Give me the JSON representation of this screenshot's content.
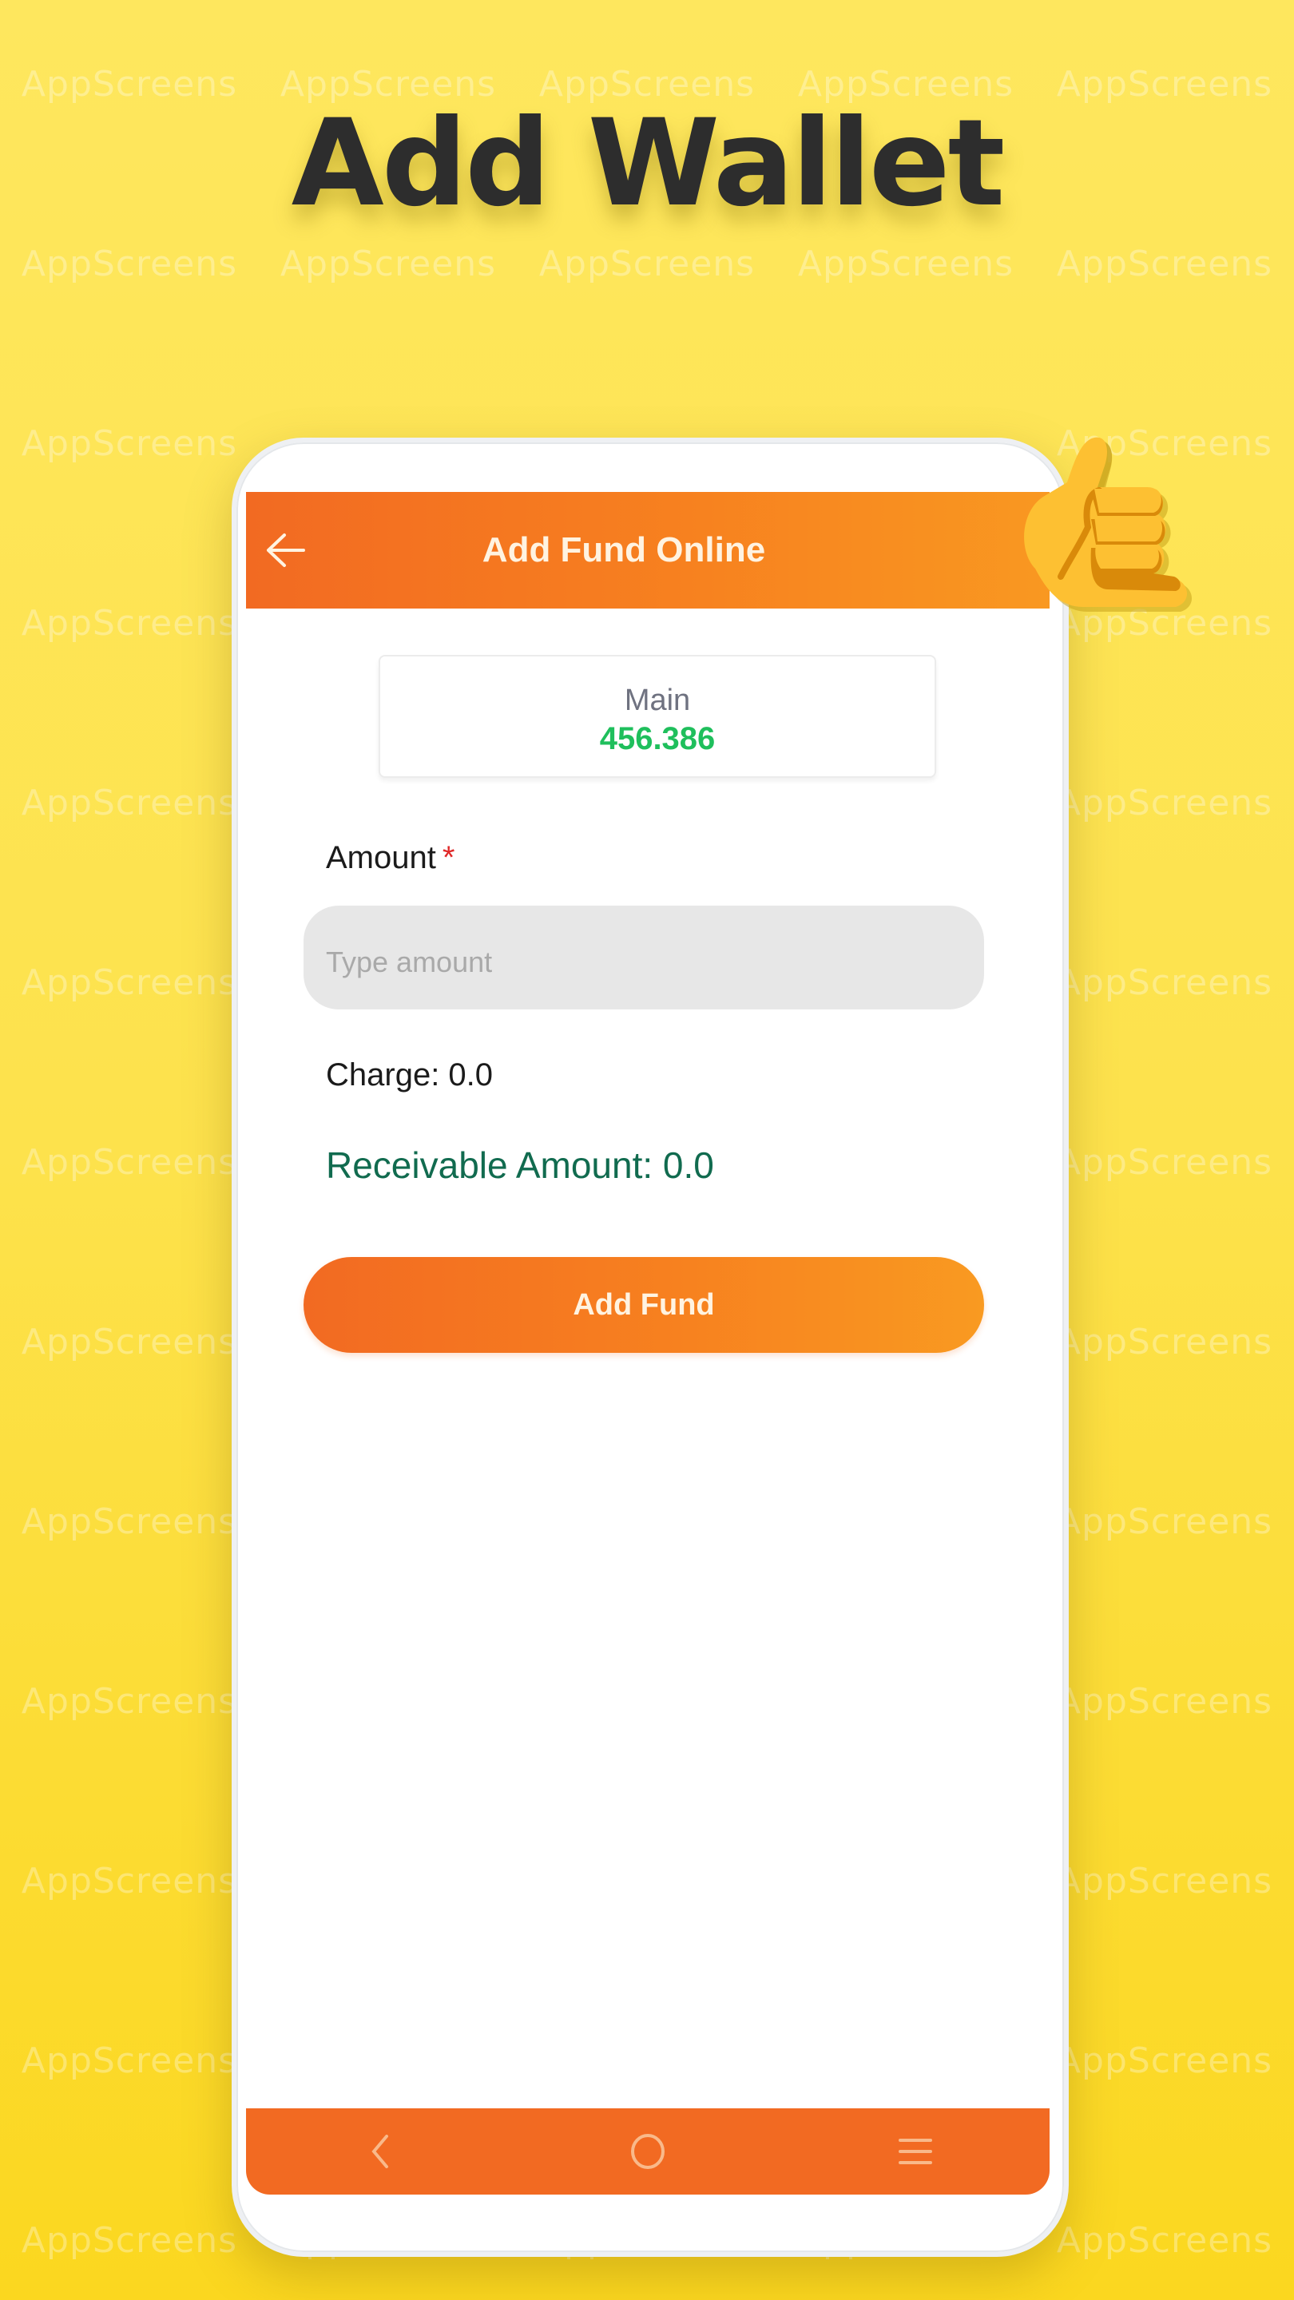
{
  "promo": {
    "headline": "Add Wallet",
    "watermark_text": "AppScreens",
    "background_color": "#fde24c",
    "decoration": "thumbs-up-icon"
  },
  "app": {
    "appbar": {
      "title": "Add Fund Online",
      "back_icon": "arrow-left-icon",
      "gradient": [
        "#f26a22",
        "#f99821"
      ]
    },
    "balance_card": {
      "label": "Main",
      "value": "456.386",
      "value_color": "#1fbf5c"
    },
    "amount_field": {
      "label": "Amount",
      "required_marker": "*",
      "placeholder": "Type amount",
      "value": ""
    },
    "charge_text": "Charge: 0.0",
    "receivable_text": "Receivable Amount: 0.0",
    "submit_button": {
      "label": "Add Fund"
    },
    "system_nav": {
      "items": [
        {
          "icon": "back-chevron-icon"
        },
        {
          "icon": "home-circle-icon"
        },
        {
          "icon": "menu-lines-icon"
        }
      ],
      "color": "#f26a22"
    }
  }
}
